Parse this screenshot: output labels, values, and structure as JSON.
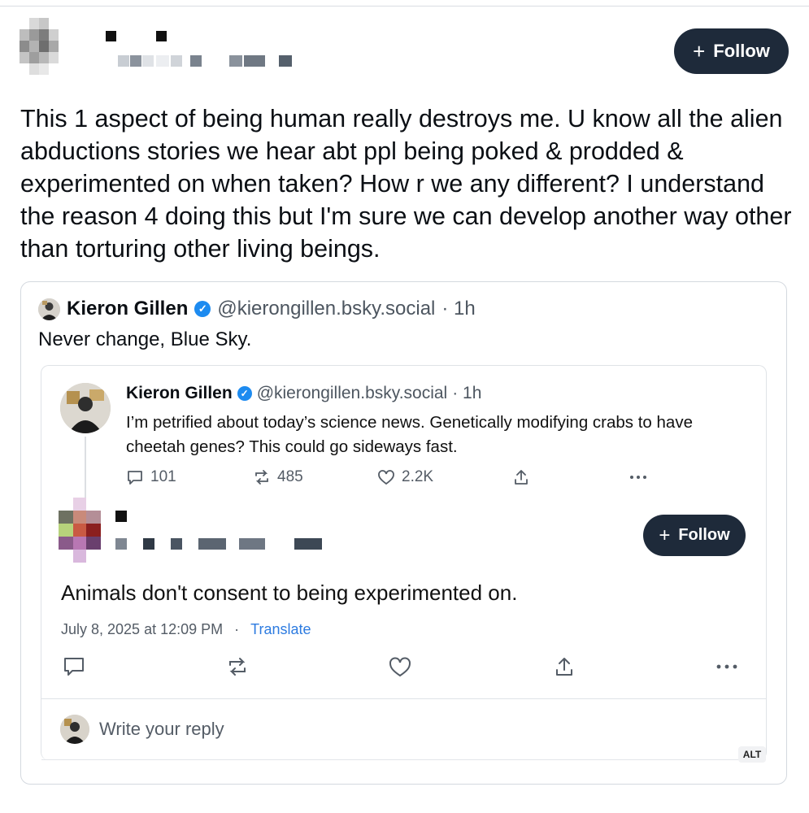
{
  "main_post": {
    "follow_label": "Follow",
    "text": "This 1 aspect of being human really destroys me. U know all the alien abductions stories we hear abt ppl being poked & prodded & experimented on when taken? How r we any different? I understand the reason 4 doing this but I'm sure we can develop another way other than torturing other living beings."
  },
  "quoted_post": {
    "author": "Kieron Gillen",
    "handle": "@kierongillen.bsky.social",
    "time": "· 1h",
    "text": "Never change, Blue Sky."
  },
  "embedded_screenshot": {
    "original_post": {
      "author": "Kieron Gillen",
      "handle": "@kierongillen.bsky.social",
      "time": "· 1h",
      "text": "I’m petrified about today’s science news. Genetically modifying crabs to have cheetah genes? This could go sideways fast.",
      "replies": "101",
      "reposts": "485",
      "likes": "2.2K"
    },
    "reply": {
      "follow_label": "Follow",
      "text": "Animals don't consent to being experimented on.",
      "timestamp": "July 8, 2025 at 12:09 PM",
      "separator": "·",
      "translate_label": "Translate"
    },
    "write_reply_placeholder": "Write your reply",
    "alt_badge": "ALT"
  },
  "colors": {
    "follow_bg": "#1e2a3a",
    "verified_blue": "#1d8bf0",
    "link_blue": "#2d7be0"
  }
}
